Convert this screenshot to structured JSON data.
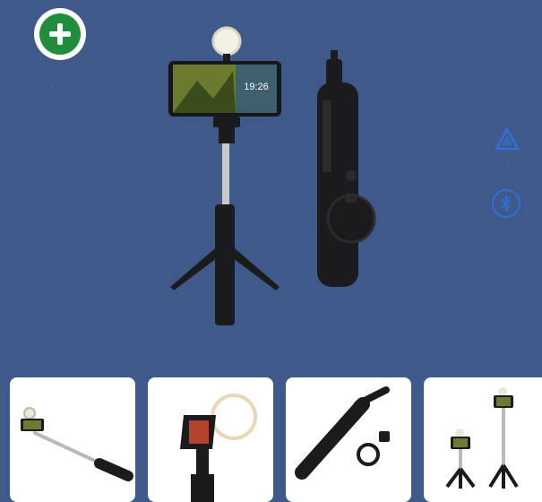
{
  "header": {
    "add_button_label": "+",
    "add_icon": "plus-circle-icon",
    "ghost_text": "· · · · · · · · · · ·"
  },
  "brand": {
    "logo_icon": "triangle-logo-icon",
    "wordmark": "• • • • • • • • • •"
  },
  "badges": {
    "bluetooth_icon": "bluetooth-icon"
  },
  "hero": {
    "phone_clock": "19:26",
    "light_icon": "ring-light-icon"
  },
  "thumbnails": [
    {
      "name": "thumb-extended-selfie-stick"
    },
    {
      "name": "thumb-ring-light-closeup"
    },
    {
      "name": "thumb-folded-stick-with-remote"
    },
    {
      "name": "thumb-tripod-heights"
    }
  ],
  "colors": {
    "background": "#3f5a8a",
    "accent_green": "#1f8d3a",
    "brand_blue": "#2f6fd6",
    "product_black": "#1b1b1d"
  }
}
